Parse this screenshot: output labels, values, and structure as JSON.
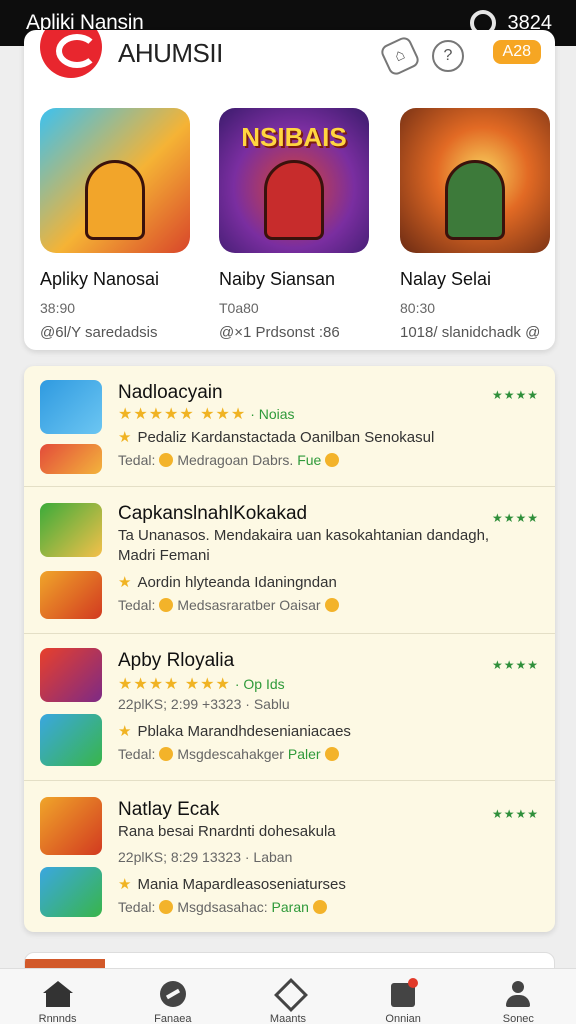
{
  "status_bar": {
    "title": "Apliki Nansin",
    "time": "3824"
  },
  "featured": {
    "title": "AHUMSII",
    "badge": "A28",
    "games": [
      {
        "name": "Apliky Nanosai",
        "meta": "38:90",
        "meta2": "@6l/Y saredadsis",
        "art_text": ""
      },
      {
        "name": "Naiby Siansan",
        "meta": "T0a80",
        "meta2": "@×1 Prdsonst :86",
        "art_text": "NSIBAIS"
      },
      {
        "name": "Nalay Selai",
        "meta": "80:30",
        "meta2": "1018/ slanidchadk @",
        "art_text": ""
      }
    ]
  },
  "list": [
    {
      "title": "Nadloacyain",
      "stars": "★★★★★ ★★★",
      "rating_label": "· Noias",
      "line2": "Pedaliz Kardanstactada Oanilban Senokasul",
      "line3_a": "Tedal:",
      "line3_b": "Medragoan Dabrs.",
      "line3_c": "Fue",
      "rank": "★★★★"
    },
    {
      "title": "CapkanslnahlKokakad",
      "line1": "Ta Unanasos. Mendakaira uan kasokahtanian dandagh,",
      "line1b": "Madri Femani",
      "line2": "Aordin hlyteanda Idaningndan",
      "line3_a": "Tedal:",
      "line3_b": "Medsasraratber Oaisar",
      "rank": "★★★★"
    },
    {
      "title": "Apby Rloyalia",
      "stars": "★★★★ ★★★",
      "rating_label": "· Op Ids",
      "line1": "22plKS; 2:99 +3323 · Sablu",
      "line2": "Pblaka Marandhdesenianiacaes",
      "line3_a": "Tedal:",
      "line3_b": "Msgdescahakger",
      "line3_c": "Paler",
      "rank": "★★★★"
    },
    {
      "title": "Natlay Ecak",
      "line1": "Rana besai Rnardnti dohesakula",
      "line1b": "22plKS; 8:29 13323 · Laban",
      "line2": "Mania Mapardleasoseniaturses",
      "line3_a": "Tedal:",
      "line3_b": "Msgdsasahac:",
      "line3_c": "Paran",
      "rank": "★★★★"
    }
  ],
  "bottom_nav": [
    {
      "label": "Rnnnds"
    },
    {
      "label": "Fanaea"
    },
    {
      "label": "Maants"
    },
    {
      "label": "Onnian"
    },
    {
      "label": "Sonec"
    }
  ]
}
